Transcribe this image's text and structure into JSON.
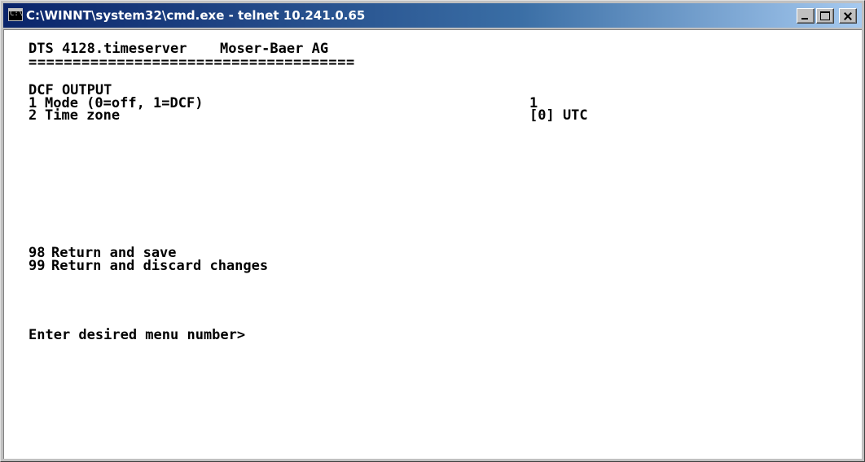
{
  "window": {
    "title": "C:\\WINNT\\system32\\cmd.exe - telnet 10.241.0.65",
    "icon": "cmd-console-icon",
    "controls": {
      "minimize_icon": "minimize-icon",
      "maximize_icon": "maximize-icon",
      "close_icon": "close-icon"
    }
  },
  "colors": {
    "titlebar_start": "#0a246a",
    "titlebar_end": "#a6caf0",
    "console_background": "#ffffff",
    "console_text": "#000000"
  },
  "terminal": {
    "header": {
      "product": "DTS 4128.timeserver",
      "company": "Moser-Baer AG",
      "separator": "====================================="
    },
    "section_title": "DCF OUTPUT",
    "settings": [
      {
        "number": "1",
        "label": "Mode (0=off, 1=DCF)",
        "value": "1"
      },
      {
        "number": "2",
        "label": "Time zone",
        "value": "[0] UTC"
      }
    ],
    "actions": [
      {
        "number": "98",
        "label": "Return and save"
      },
      {
        "number": "99",
        "label": "Return and discard changes"
      }
    ],
    "prompt": "Enter desired menu number>"
  }
}
